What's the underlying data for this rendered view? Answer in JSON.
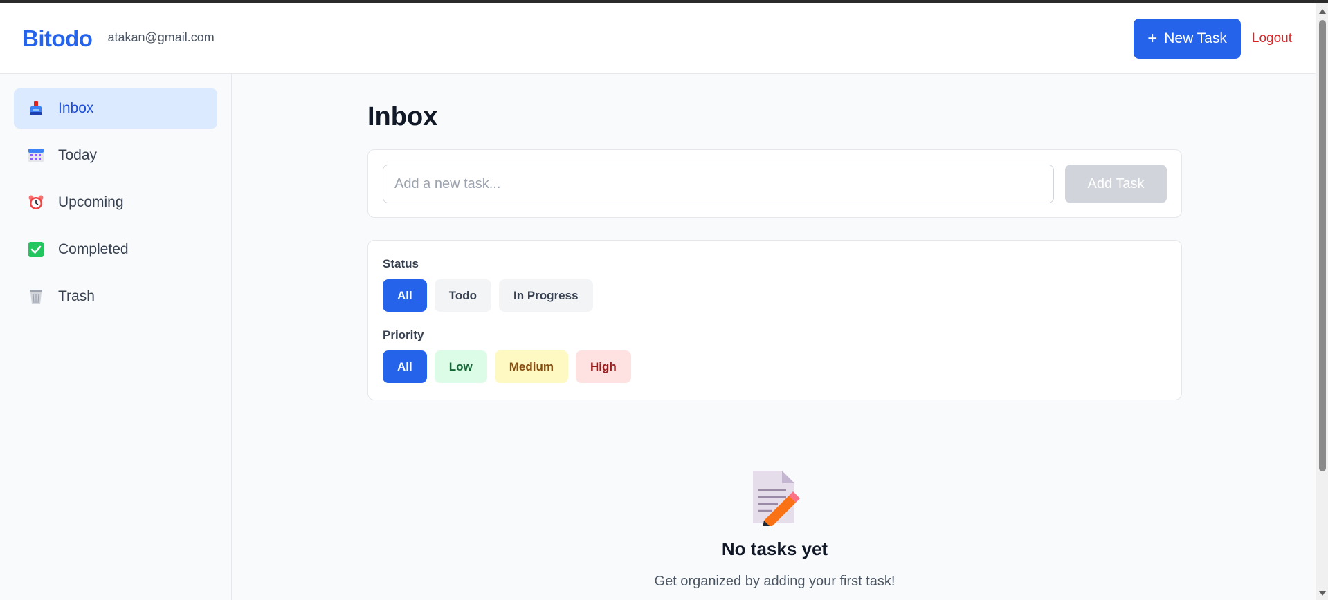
{
  "header": {
    "brand": "Bitodo",
    "email": "atakan@gmail.com",
    "new_task_icon": "+",
    "new_task_label": "New Task",
    "logout_label": "Logout"
  },
  "sidebar": {
    "items": [
      {
        "label": "Inbox",
        "icon": "inbox-tray-icon",
        "active": true
      },
      {
        "label": "Today",
        "icon": "calendar-icon",
        "active": false
      },
      {
        "label": "Upcoming",
        "icon": "alarm-clock-icon",
        "active": false
      },
      {
        "label": "Completed",
        "icon": "check-box-icon",
        "active": false
      },
      {
        "label": "Trash",
        "icon": "trash-basket-icon",
        "active": false
      }
    ]
  },
  "main": {
    "title": "Inbox",
    "add_task": {
      "placeholder": "Add a new task...",
      "value": "",
      "button_label": "Add Task"
    },
    "filters": {
      "status_label": "Status",
      "status_options": [
        "All",
        "Todo",
        "In Progress"
      ],
      "status_selected": "All",
      "priority_label": "Priority",
      "priority_options": [
        "All",
        "Low",
        "Medium",
        "High"
      ],
      "priority_selected": "All"
    },
    "empty_state": {
      "icon": "memo-pencil-icon",
      "title": "No tasks yet",
      "subtitle": "Get organized by adding your first task!"
    }
  },
  "colors": {
    "accent": "#2563eb",
    "danger": "#dc2626",
    "active_nav_bg": "#dbeafe",
    "low_bg": "#dcfce7",
    "medium_bg": "#fef9c3",
    "high_bg": "#fee2e2"
  }
}
